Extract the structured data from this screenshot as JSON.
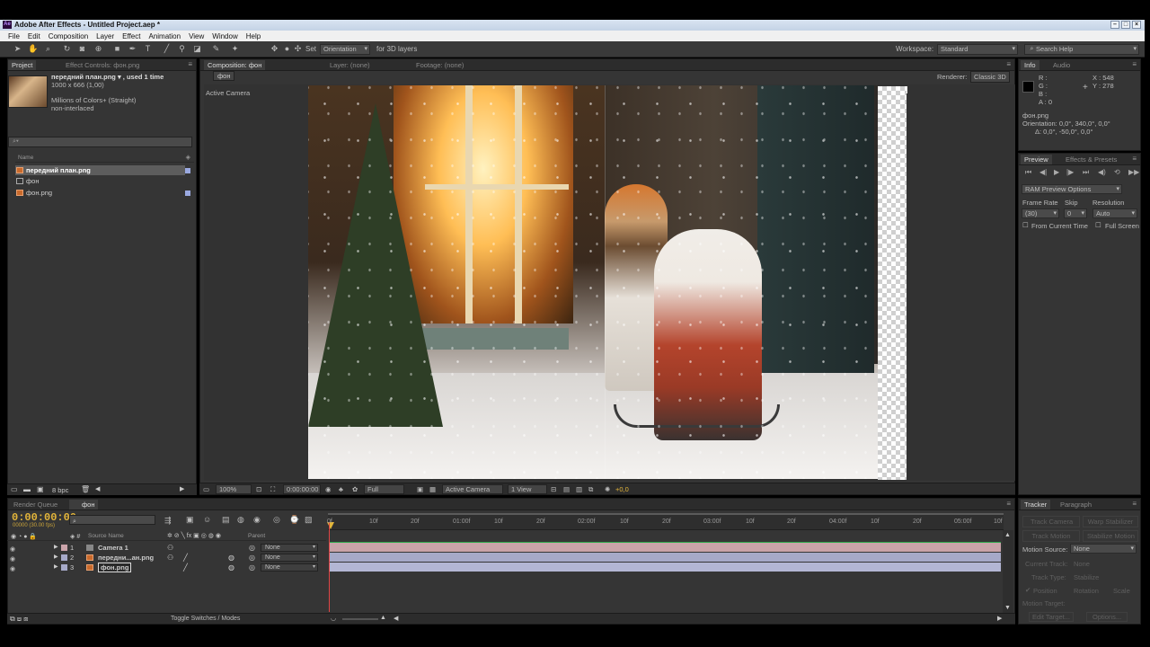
{
  "window": {
    "title": "Adobe After Effects - Untitled Project.aep *",
    "app_badge": "Ae"
  },
  "menu": [
    "File",
    "Edit",
    "Composition",
    "Layer",
    "Effect",
    "Animation",
    "View",
    "Window",
    "Help"
  ],
  "toolbar": {
    "set_label": "Set",
    "orientation_dropdown": "Orientation",
    "for3d_label": "for 3D layers",
    "workspace_label": "Workspace:",
    "workspace_value": "Standard",
    "search_help": "Search Help"
  },
  "project_panel": {
    "tabs": [
      "Project",
      "Effect Controls: фон.png"
    ],
    "selected_item": "передний план.png ▾ , used 1 time",
    "dimensions": "1000 x 666 (1,00)",
    "color_info": "Millions of Colors+ (Straight)",
    "interlace": "non-interlaced",
    "search_placeholder": "",
    "column_name": "Name",
    "items": [
      {
        "name": "передний план.png",
        "kind": "file",
        "selected": true
      },
      {
        "name": "фон",
        "kind": "comp",
        "selected": false
      },
      {
        "name": "фон.png",
        "kind": "file",
        "selected": false
      }
    ],
    "bpc": "8 bpc"
  },
  "comp_panel": {
    "tabs": [
      "Composition: фон",
      "Layer: (none)",
      "Footage: (none)"
    ],
    "breadcrumb": "фон",
    "renderer_label": "Renderer:",
    "renderer_value": "Classic 3D",
    "camera_label": "Active Camera",
    "footer": {
      "zoom": "100%",
      "timecode": "0:00:00:00",
      "resolution": "Full",
      "view": "Active Camera",
      "layout": "1 View",
      "exposure": "+0,0"
    }
  },
  "info_panel": {
    "tabs": [
      "Info",
      "Audio"
    ],
    "r": "R :",
    "g": "G :",
    "b": "B :",
    "a": "A : 0",
    "x": "X : 548",
    "y": "Y : 278",
    "layer": "фон.png",
    "orientation": "Orientation: 0,0°, 340,0°, 0,0°",
    "delta": "Δ: 0,0°, -50,0°, 0,0°"
  },
  "preview_panel": {
    "tabs": [
      "Preview",
      "Effects & Presets"
    ],
    "options": "RAM Preview Options",
    "frame_rate_label": "Frame Rate",
    "skip_label": "Skip",
    "resolution_label": "Resolution",
    "frame_rate": "(30)",
    "skip": "0",
    "resolution": "Auto",
    "from_current": "From Current Time",
    "full_screen": "Full Screen"
  },
  "tracker_panel": {
    "tabs": [
      "Tracker",
      "Paragraph"
    ],
    "track_camera": "Track Camera",
    "warp_stabilizer": "Warp Stabilizer",
    "track_motion": "Track Motion",
    "stabilize_motion": "Stabilize Motion",
    "motion_source_label": "Motion Source:",
    "motion_source": "None",
    "current_track_label": "Current Track:",
    "current_track": "None",
    "track_type_label": "Track Type:",
    "track_type": "Stabilize",
    "position": "Position",
    "rotation": "Rotation",
    "scale": "Scale",
    "motion_target": "Motion Target:",
    "edit_target": "Edit Target...",
    "options": "Options..."
  },
  "timeline": {
    "tabs": [
      "Render Queue",
      "фон"
    ],
    "timecode": "0:00:00:00",
    "fps": "00000 (30.00 fps)",
    "col_source": "Source Name",
    "col_parent": "Parent",
    "toggle": "Toggle Switches / Modes",
    "ruler": [
      "0f",
      "10f",
      "20f",
      "01:00f",
      "10f",
      "20f",
      "02:00f",
      "10f",
      "20f",
      "03:00f",
      "10f",
      "20f",
      "04:00f",
      "10f",
      "20f",
      "05:00f",
      "10f"
    ],
    "layers": [
      {
        "num": "1",
        "name": "Camera 1",
        "parent": "None",
        "type": "camera"
      },
      {
        "num": "2",
        "name": "передни...ан.png",
        "parent": "None",
        "type": "footage"
      },
      {
        "num": "3",
        "name": "фон.png",
        "parent": "None",
        "type": "footage"
      }
    ],
    "colors": {
      "camera_bar": "#c9a3a9",
      "layer_bar": "#a6a9c8",
      "playhead": "#e04545"
    }
  }
}
